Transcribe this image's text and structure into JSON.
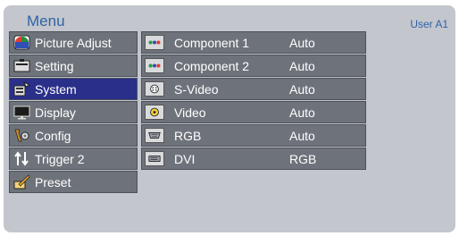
{
  "header": {
    "title": "Menu",
    "user": "User A1"
  },
  "left_menu": [
    {
      "label": "Picture Adjust",
      "icon": "picture-adjust-icon"
    },
    {
      "label": "Setting",
      "icon": "setting-icon"
    },
    {
      "label": "System",
      "icon": "system-icon",
      "selected": true
    },
    {
      "label": "Display",
      "icon": "display-icon"
    },
    {
      "label": "Config",
      "icon": "config-icon"
    },
    {
      "label": "Trigger 2",
      "icon": "trigger-icon"
    },
    {
      "label": "Preset",
      "icon": "preset-icon"
    }
  ],
  "sources": [
    {
      "name": "Component 1",
      "value": "Auto",
      "icon": "component-icon"
    },
    {
      "name": "Component 2",
      "value": "Auto",
      "icon": "component-icon"
    },
    {
      "name": "S-Video",
      "value": "Auto",
      "icon": "svideo-icon"
    },
    {
      "name": "Video",
      "value": "Auto",
      "icon": "video-icon"
    },
    {
      "name": "RGB",
      "value": "Auto",
      "icon": "rgb-icon"
    },
    {
      "name": "DVI",
      "value": "RGB",
      "icon": "dvi-icon"
    }
  ],
  "colors": {
    "panel": "#c3c6cc",
    "item": "#6e737b",
    "selected": "#2a2f8a",
    "title": "#2f63a8"
  }
}
